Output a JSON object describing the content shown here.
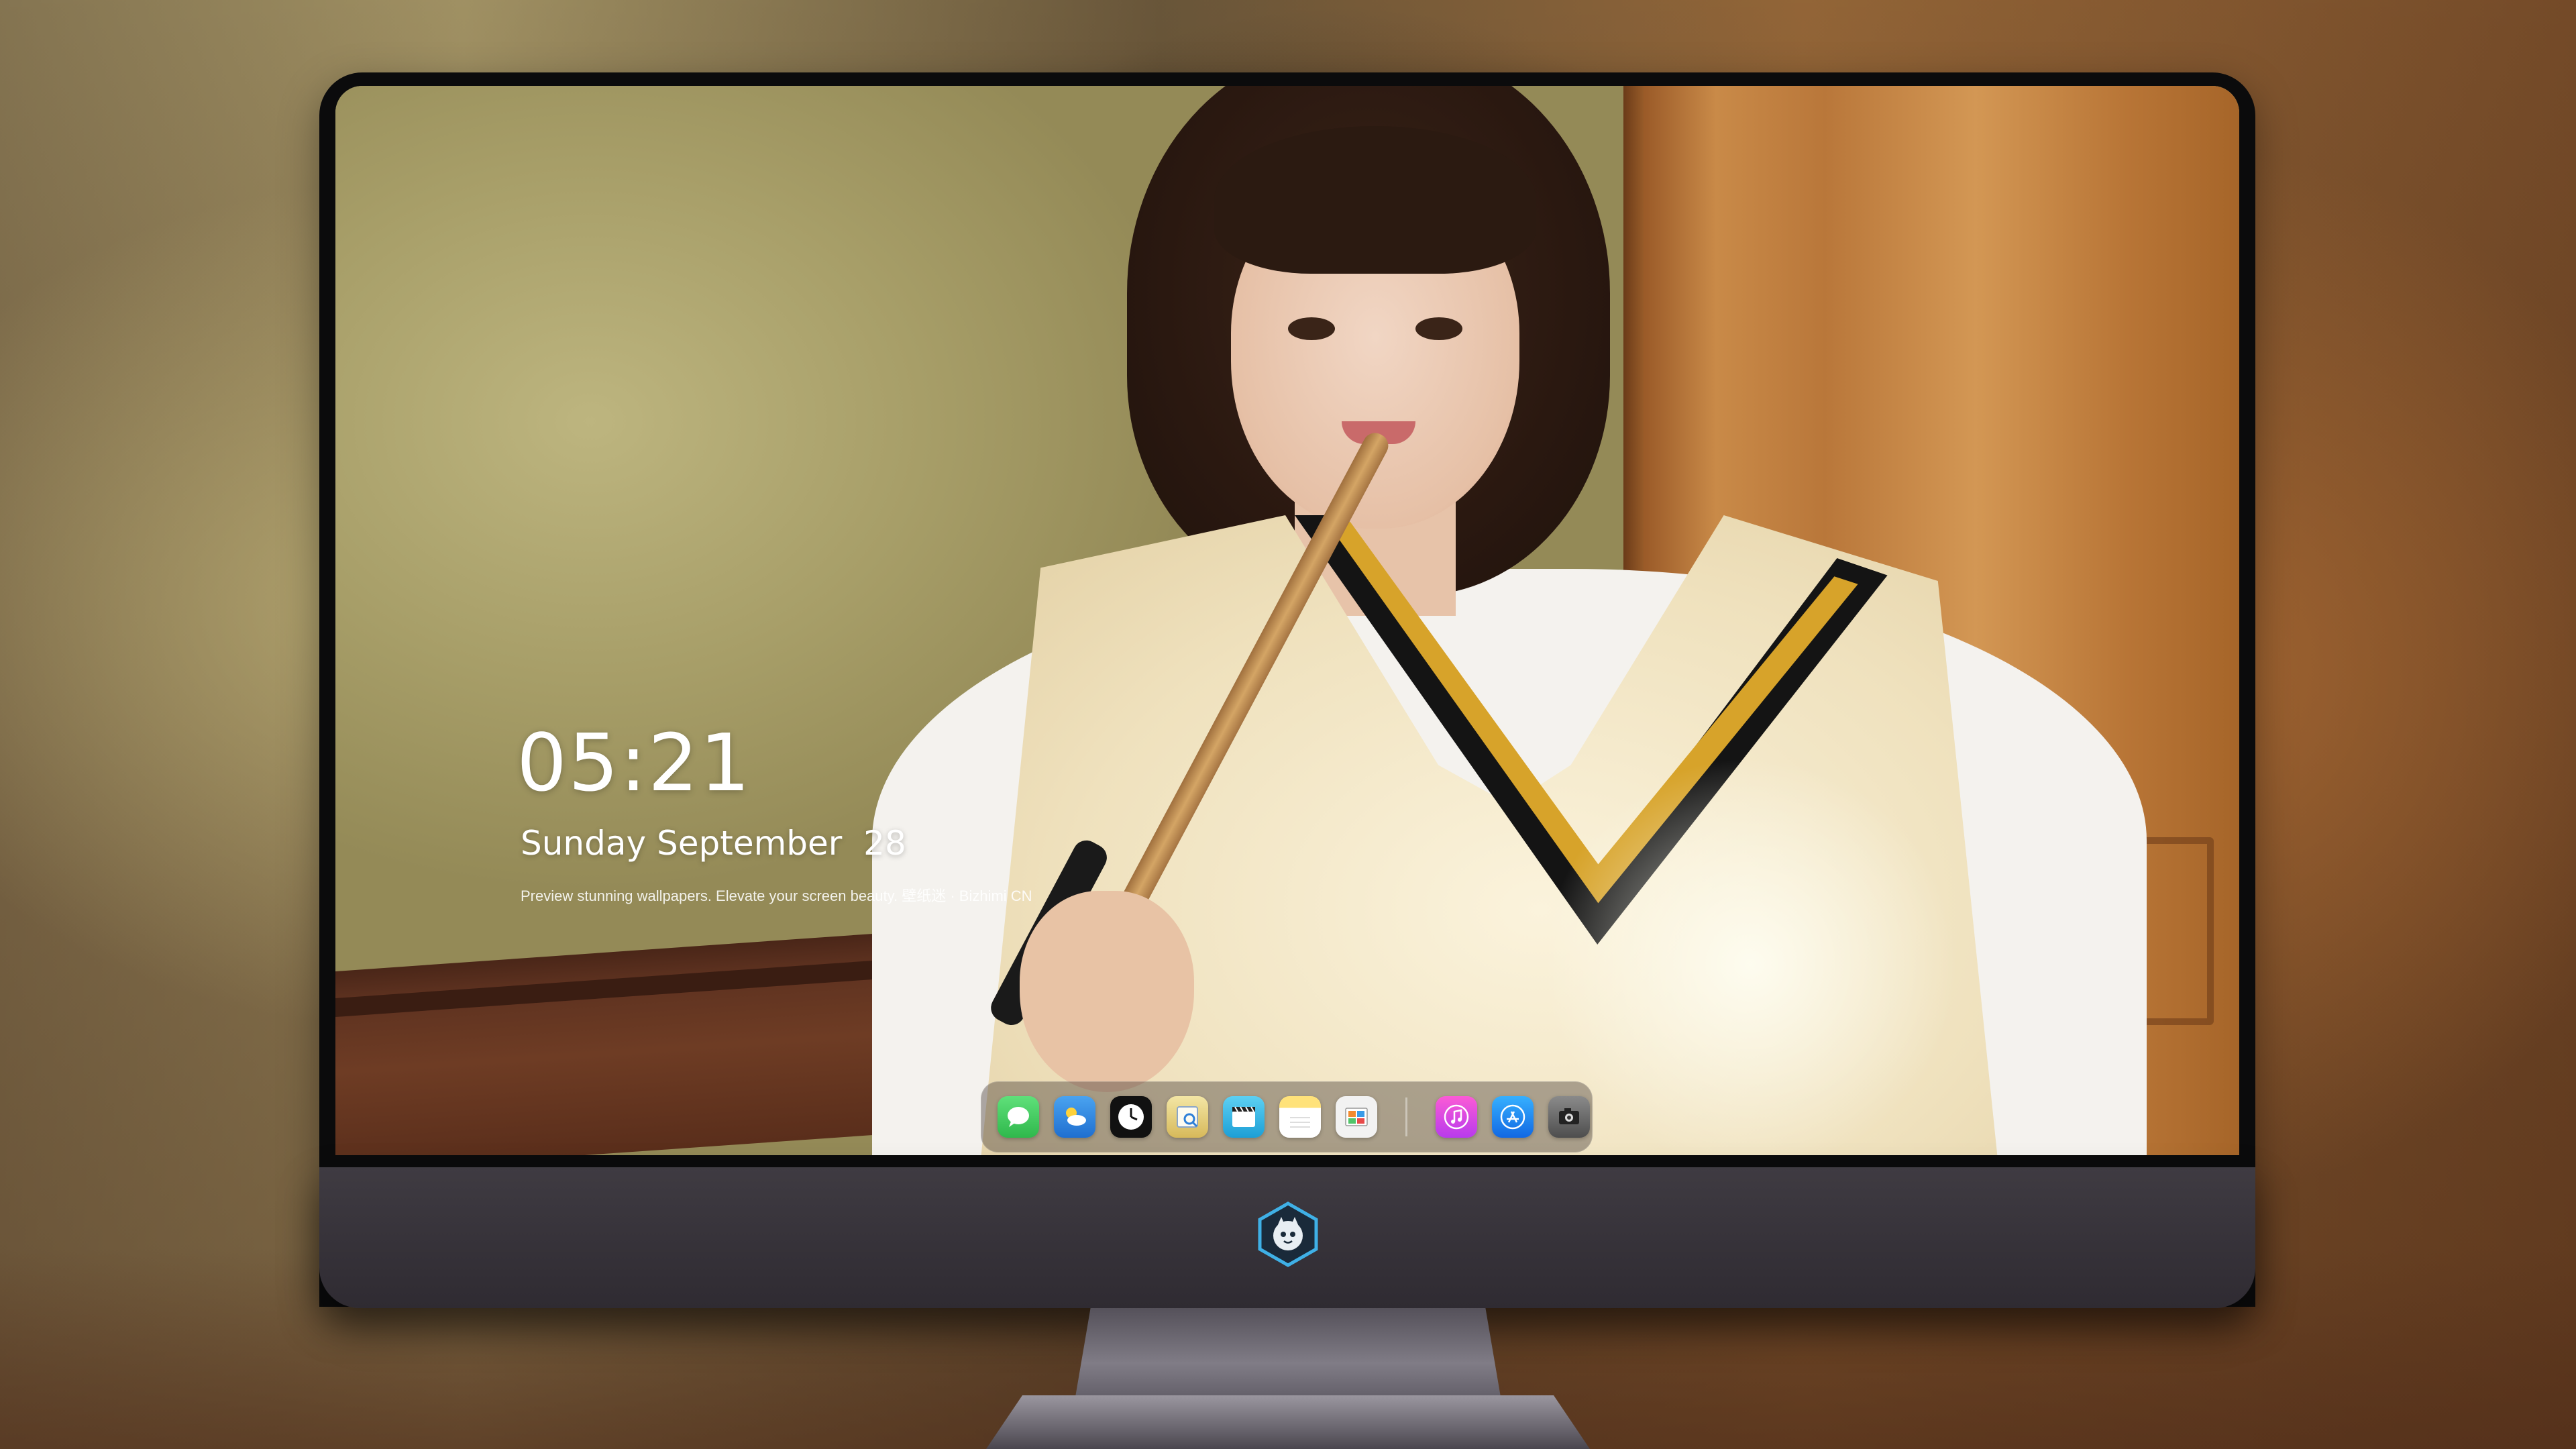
{
  "lockscreen": {
    "time": "05:21",
    "date": "Sunday September  28",
    "caption": "Preview stunning wallpapers. Elevate your screen beauty. 壁纸迷 · Bizhimi CN"
  },
  "dock": {
    "items": [
      {
        "icon": "messages-icon",
        "color": "#34c759"
      },
      {
        "icon": "weather-icon",
        "color": "#3a8ee6"
      },
      {
        "icon": "clock-icon",
        "color": "#ffffff"
      },
      {
        "icon": "preview-icon",
        "color": "#e7d28a"
      },
      {
        "icon": "video-icon",
        "color": "#3bb6e8"
      },
      {
        "icon": "notes-icon",
        "color": "#ffd54a"
      },
      {
        "icon": "photo-browser-icon",
        "color": "#e8e8e8"
      },
      {
        "icon": "music-icon",
        "color": "#e83ad1"
      },
      {
        "icon": "app-store-icon",
        "color": "#1f8cff"
      },
      {
        "icon": "camera-icon",
        "color": "#6a6a6a"
      }
    ]
  },
  "colors": {
    "monitor_bezel": "#0b0b0c",
    "monitor_chin": "#3a363d",
    "logo_accent": "#3fb0e6"
  }
}
